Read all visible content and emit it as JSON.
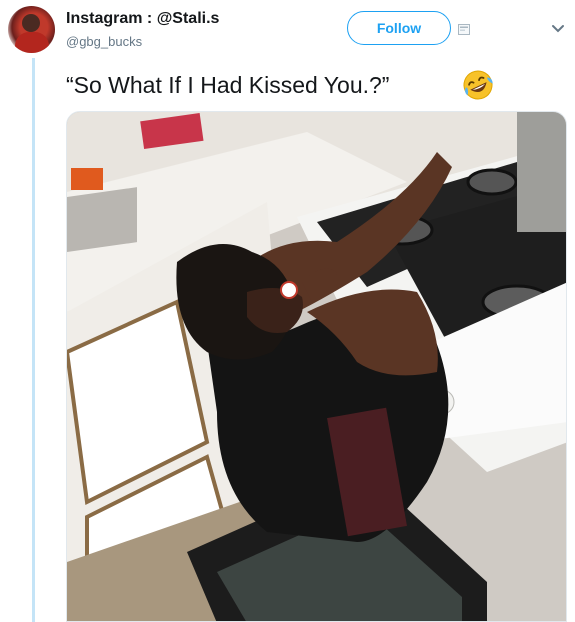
{
  "tweet": {
    "author_name": "Instagram : @Stali.s",
    "author_handle": "@gbg_bucks",
    "follow_label": "Follow",
    "text": "“So What If I Had Kissed You.?”",
    "emoji": "rolling-on-floor-laughing-emoji",
    "media": {
      "type": "photo",
      "scene": "person in black shirt leaning over a white gas stove in a kitchen"
    }
  },
  "icons": {
    "avatar": "profile-avatar",
    "embed": "tweet-embed-icon",
    "menu": "chevron-down-icon"
  },
  "colors": {
    "accent": "#1da1f2",
    "thread_line": "#c4e4f7",
    "text": "#14171a",
    "muted": "#657786"
  }
}
